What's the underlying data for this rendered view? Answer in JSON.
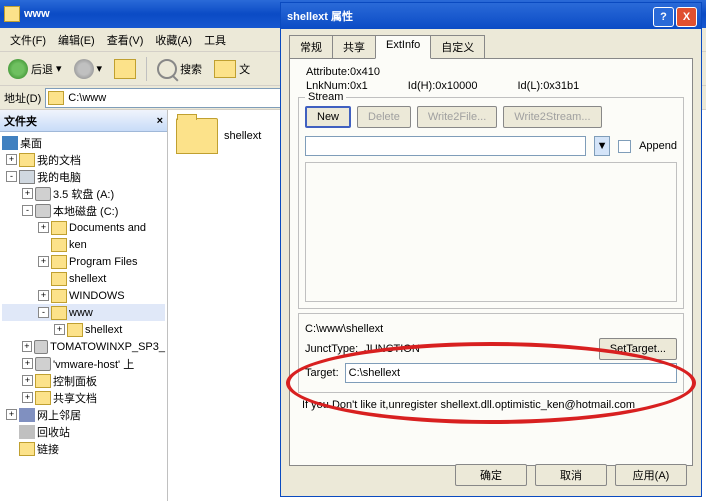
{
  "explorer": {
    "title": "www",
    "menu": {
      "file": "文件(F)",
      "edit": "编辑(E)",
      "view": "查看(V)",
      "favorites": "收藏(A)",
      "tools": "工具"
    },
    "toolbar": {
      "back": "后退",
      "search": "搜索",
      "folders": "文"
    },
    "address": {
      "label": "地址(D)",
      "path": "C:\\www"
    },
    "tree": {
      "header": "文件夹",
      "close": "×",
      "nodes": {
        "desktop": "桌面",
        "mydocs": "我的文档",
        "mycomputer": "我的电脑",
        "floppy": "3.5 软盘 (A:)",
        "cdrive": "本地磁盘 (C:)",
        "docs_and": "Documents and",
        "ken": "ken",
        "progfiles": "Program Files",
        "shellext_f": "shellext",
        "windows": "WINDOWS",
        "www": "www",
        "shellext_sub": "shellext",
        "tomato": "TOMATOWINXP_SP3_",
        "vmware": "'vmware-host' 上",
        "ctrlpanel": "控制面板",
        "shared": "共享文档",
        "network": "网上邻居",
        "recycle": "回收站",
        "links": "链接"
      }
    },
    "file_item": "shellext"
  },
  "dialog": {
    "title": "shellext 属性",
    "help": "?",
    "close": "X",
    "tabs": {
      "general": "常规",
      "sharing": "共享",
      "extinfo": "ExtInfo",
      "custom": "自定义"
    },
    "attribute_label": "Attribute:",
    "attribute_value": "0x410",
    "lnknum_label": "LnkNum:",
    "lnknum_value": "0x1",
    "idh_label": "Id(H):",
    "idh_value": "0x10000",
    "idl_label": "Id(L):",
    "idl_value": "0x31b1",
    "stream": {
      "legend": "Stream",
      "new": "New",
      "delete": "Delete",
      "write2file": "Write2File...",
      "write2stream": "Write2Stream...",
      "append": "Append"
    },
    "junct": {
      "path": "C:\\www\\shellext",
      "type_label": "JunctType:",
      "type_value": "JUNCTION",
      "settarget": "SetTarget...",
      "target_label": "Target:",
      "target_value": "C:\\shellext"
    },
    "footer": "If you Don't like it,unregister shellext.dll.optimistic_ken@hotmail.com",
    "buttons": {
      "ok": "确定",
      "cancel": "取消",
      "apply": "应用(A)"
    }
  }
}
